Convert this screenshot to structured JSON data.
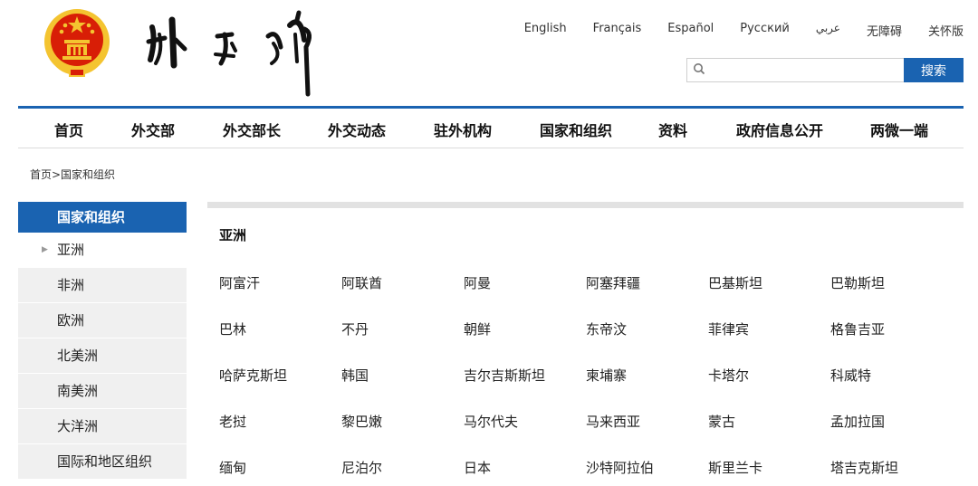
{
  "header": {
    "languages": [
      "English",
      "Français",
      "Español",
      "Русский",
      "عربي",
      "无障碍",
      "关怀版"
    ],
    "search": {
      "placeholder": "",
      "button_label": "搜索"
    }
  },
  "nav": {
    "items": [
      "首页",
      "外交部",
      "外交部长",
      "外交动态",
      "驻外机构",
      "国家和组织",
      "资料",
      "政府信息公开",
      "两微一端"
    ]
  },
  "breadcrumb": "首页>国家和组织",
  "sidebar": {
    "title": "国家和组织",
    "items": [
      "亚洲",
      "非洲",
      "欧洲",
      "北美洲",
      "南美洲",
      "大洋洲",
      "国际和地区组织"
    ],
    "active_index": 0
  },
  "main": {
    "region_title": "亚洲",
    "countries": [
      [
        "阿富汗",
        "阿联酋",
        "阿曼",
        "阿塞拜疆",
        "巴基斯坦",
        "巴勒斯坦"
      ],
      [
        "巴林",
        "不丹",
        "朝鲜",
        "东帝汶",
        "菲律宾",
        "格鲁吉亚"
      ],
      [
        "哈萨克斯坦",
        "韩国",
        "吉尔吉斯斯坦",
        "柬埔寨",
        "卡塔尔",
        "科威特"
      ],
      [
        "老挝",
        "黎巴嫩",
        "马尔代夫",
        "马来西亚",
        "蒙古",
        "孟加拉国"
      ],
      [
        "缅甸",
        "尼泊尔",
        "日本",
        "沙特阿拉伯",
        "斯里兰卡",
        "塔吉克斯坦"
      ]
    ]
  },
  "colors": {
    "brand_blue": "#1a63b1",
    "emblem_red": "#d81e06",
    "emblem_gold": "#f4c430"
  },
  "icons": {
    "emblem": "national-emblem-icon",
    "search": "search-icon",
    "arrow": "triangle-right-icon"
  }
}
